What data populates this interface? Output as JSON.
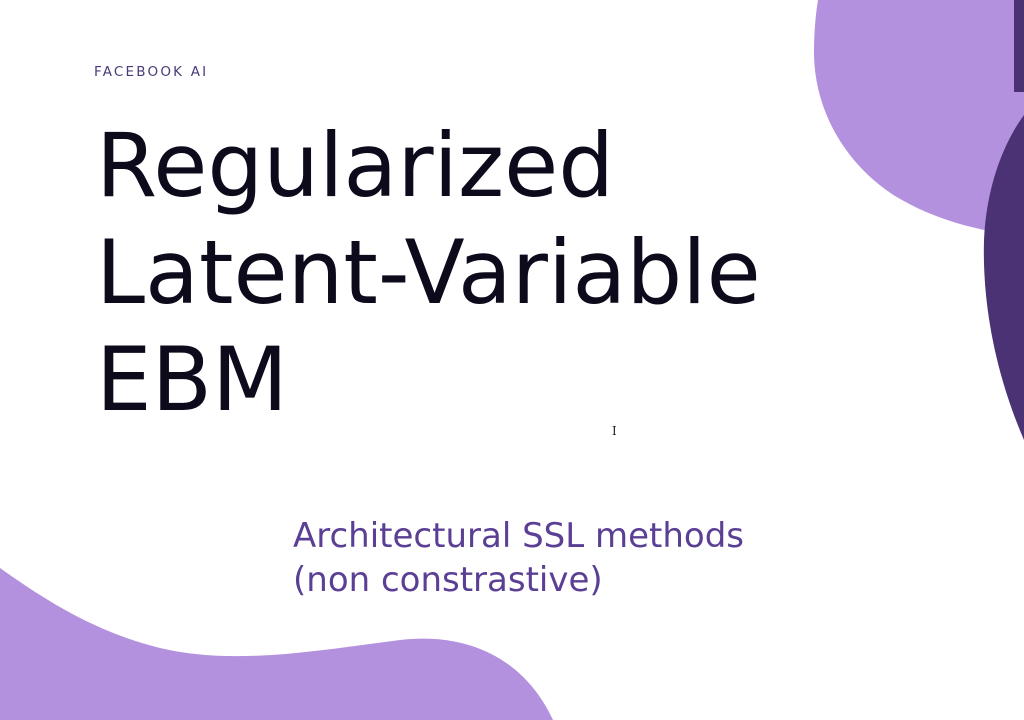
{
  "slide": {
    "brand": "FACEBOOK AI",
    "title_lines": [
      "Regularized",
      "Latent-Variable",
      "EBM"
    ],
    "subtitle_lines": [
      "Architectural SSL methods",
      "(non constrastive)"
    ],
    "cursor_glyph": "I"
  },
  "colors": {
    "background": "#ffffff",
    "light_purple": "#b391de",
    "dark_purple": "#4a3274",
    "brand_text": "#4b3a78",
    "title_text": "#0d0a1c",
    "subtitle_text": "#5b3f94"
  },
  "icons": {
    "cursor": "text-cursor-icon"
  }
}
